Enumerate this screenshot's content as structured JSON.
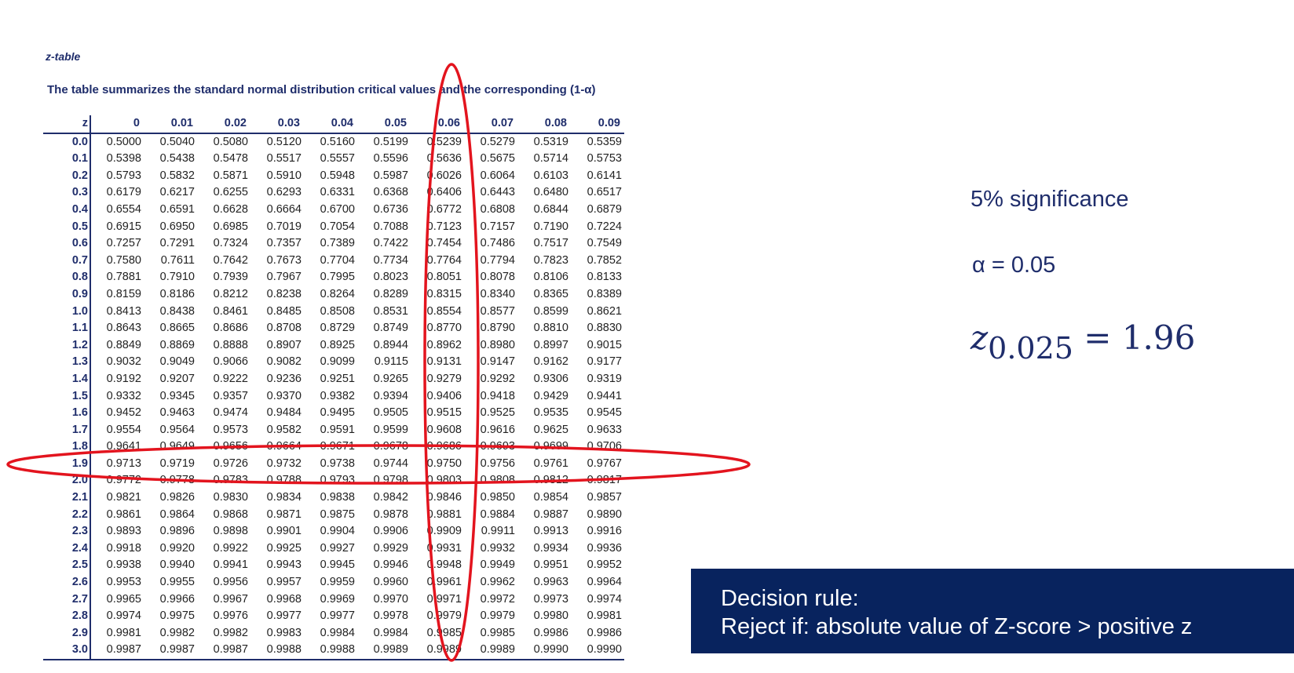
{
  "title": "z-table",
  "caption": "The table summarizes the standard normal distribution critical values and the corresponding (1-α)",
  "table": {
    "header": [
      "z",
      "0",
      "0.01",
      "0.02",
      "0.03",
      "0.04",
      "0.05",
      "0.06",
      "0.07",
      "0.08",
      "0.09"
    ],
    "rows": [
      [
        "0.0",
        "0.5000",
        "0.5040",
        "0.5080",
        "0.5120",
        "0.5160",
        "0.5199",
        "0.5239",
        "0.5279",
        "0.5319",
        "0.5359"
      ],
      [
        "0.1",
        "0.5398",
        "0.5438",
        "0.5478",
        "0.5517",
        "0.5557",
        "0.5596",
        "0.5636",
        "0.5675",
        "0.5714",
        "0.5753"
      ],
      [
        "0.2",
        "0.5793",
        "0.5832",
        "0.5871",
        "0.5910",
        "0.5948",
        "0.5987",
        "0.6026",
        "0.6064",
        "0.6103",
        "0.6141"
      ],
      [
        "0.3",
        "0.6179",
        "0.6217",
        "0.6255",
        "0.6293",
        "0.6331",
        "0.6368",
        "0.6406",
        "0.6443",
        "0.6480",
        "0.6517"
      ],
      [
        "0.4",
        "0.6554",
        "0.6591",
        "0.6628",
        "0.6664",
        "0.6700",
        "0.6736",
        "0.6772",
        "0.6808",
        "0.6844",
        "0.6879"
      ],
      [
        "0.5",
        "0.6915",
        "0.6950",
        "0.6985",
        "0.7019",
        "0.7054",
        "0.7088",
        "0.7123",
        "0.7157",
        "0.7190",
        "0.7224"
      ],
      [
        "0.6",
        "0.7257",
        "0.7291",
        "0.7324",
        "0.7357",
        "0.7389",
        "0.7422",
        "0.7454",
        "0.7486",
        "0.7517",
        "0.7549"
      ],
      [
        "0.7",
        "0.7580",
        "0.7611",
        "0.7642",
        "0.7673",
        "0.7704",
        "0.7734",
        "0.7764",
        "0.7794",
        "0.7823",
        "0.7852"
      ],
      [
        "0.8",
        "0.7881",
        "0.7910",
        "0.7939",
        "0.7967",
        "0.7995",
        "0.8023",
        "0.8051",
        "0.8078",
        "0.8106",
        "0.8133"
      ],
      [
        "0.9",
        "0.8159",
        "0.8186",
        "0.8212",
        "0.8238",
        "0.8264",
        "0.8289",
        "0.8315",
        "0.8340",
        "0.8365",
        "0.8389"
      ],
      [
        "1.0",
        "0.8413",
        "0.8438",
        "0.8461",
        "0.8485",
        "0.8508",
        "0.8531",
        "0.8554",
        "0.8577",
        "0.8599",
        "0.8621"
      ],
      [
        "1.1",
        "0.8643",
        "0.8665",
        "0.8686",
        "0.8708",
        "0.8729",
        "0.8749",
        "0.8770",
        "0.8790",
        "0.8810",
        "0.8830"
      ],
      [
        "1.2",
        "0.8849",
        "0.8869",
        "0.8888",
        "0.8907",
        "0.8925",
        "0.8944",
        "0.8962",
        "0.8980",
        "0.8997",
        "0.9015"
      ],
      [
        "1.3",
        "0.9032",
        "0.9049",
        "0.9066",
        "0.9082",
        "0.9099",
        "0.9115",
        "0.9131",
        "0.9147",
        "0.9162",
        "0.9177"
      ],
      [
        "1.4",
        "0.9192",
        "0.9207",
        "0.9222",
        "0.9236",
        "0.9251",
        "0.9265",
        "0.9279",
        "0.9292",
        "0.9306",
        "0.9319"
      ],
      [
        "1.5",
        "0.9332",
        "0.9345",
        "0.9357",
        "0.9370",
        "0.9382",
        "0.9394",
        "0.9406",
        "0.9418",
        "0.9429",
        "0.9441"
      ],
      [
        "1.6",
        "0.9452",
        "0.9463",
        "0.9474",
        "0.9484",
        "0.9495",
        "0.9505",
        "0.9515",
        "0.9525",
        "0.9535",
        "0.9545"
      ],
      [
        "1.7",
        "0.9554",
        "0.9564",
        "0.9573",
        "0.9582",
        "0.9591",
        "0.9599",
        "0.9608",
        "0.9616",
        "0.9625",
        "0.9633"
      ],
      [
        "1.8",
        "0.9641",
        "0.9649",
        "0.9656",
        "0.9664",
        "0.9671",
        "0.9678",
        "0.9686",
        "0.9693",
        "0.9699",
        "0.9706"
      ],
      [
        "1.9",
        "0.9713",
        "0.9719",
        "0.9726",
        "0.9732",
        "0.9738",
        "0.9744",
        "0.9750",
        "0.9756",
        "0.9761",
        "0.9767"
      ],
      [
        "2.0",
        "0.9772",
        "0.9778",
        "0.9783",
        "0.9788",
        "0.9793",
        "0.9798",
        "0.9803",
        "0.9808",
        "0.9812",
        "0.9817"
      ],
      [
        "2.1",
        "0.9821",
        "0.9826",
        "0.9830",
        "0.9834",
        "0.9838",
        "0.9842",
        "0.9846",
        "0.9850",
        "0.9854",
        "0.9857"
      ],
      [
        "2.2",
        "0.9861",
        "0.9864",
        "0.9868",
        "0.9871",
        "0.9875",
        "0.9878",
        "0.9881",
        "0.9884",
        "0.9887",
        "0.9890"
      ],
      [
        "2.3",
        "0.9893",
        "0.9896",
        "0.9898",
        "0.9901",
        "0.9904",
        "0.9906",
        "0.9909",
        "0.9911",
        "0.9913",
        "0.9916"
      ],
      [
        "2.4",
        "0.9918",
        "0.9920",
        "0.9922",
        "0.9925",
        "0.9927",
        "0.9929",
        "0.9931",
        "0.9932",
        "0.9934",
        "0.9936"
      ],
      [
        "2.5",
        "0.9938",
        "0.9940",
        "0.9941",
        "0.9943",
        "0.9945",
        "0.9946",
        "0.9948",
        "0.9949",
        "0.9951",
        "0.9952"
      ],
      [
        "2.6",
        "0.9953",
        "0.9955",
        "0.9956",
        "0.9957",
        "0.9959",
        "0.9960",
        "0.9961",
        "0.9962",
        "0.9963",
        "0.9964"
      ],
      [
        "2.7",
        "0.9965",
        "0.9966",
        "0.9967",
        "0.9968",
        "0.9969",
        "0.9970",
        "0.9971",
        "0.9972",
        "0.9973",
        "0.9974"
      ],
      [
        "2.8",
        "0.9974",
        "0.9975",
        "0.9976",
        "0.9977",
        "0.9977",
        "0.9978",
        "0.9979",
        "0.9979",
        "0.9980",
        "0.9981"
      ],
      [
        "2.9",
        "0.9981",
        "0.9982",
        "0.9982",
        "0.9983",
        "0.9984",
        "0.9984",
        "0.9985",
        "0.9985",
        "0.9986",
        "0.9986"
      ],
      [
        "3.0",
        "0.9987",
        "0.9987",
        "0.9987",
        "0.9988",
        "0.9988",
        "0.9989",
        "0.9989",
        "0.9989",
        "0.9990",
        "0.9990"
      ]
    ],
    "highlighted_row": "1.9",
    "highlighted_column": "0.06"
  },
  "annotations": {
    "significance": "5% significance",
    "alpha": "α = 0.05",
    "z_symbol": "z",
    "z_subscript": "0.025",
    "z_value": " = 1.96"
  },
  "decision": {
    "line1": "Decision rule:",
    "line2": "Reject if: absolute value of Z-score > positive z"
  },
  "colors": {
    "navy": "#1f2d6b",
    "decision_bg": "#08235e",
    "highlight": "#e3141e"
  }
}
